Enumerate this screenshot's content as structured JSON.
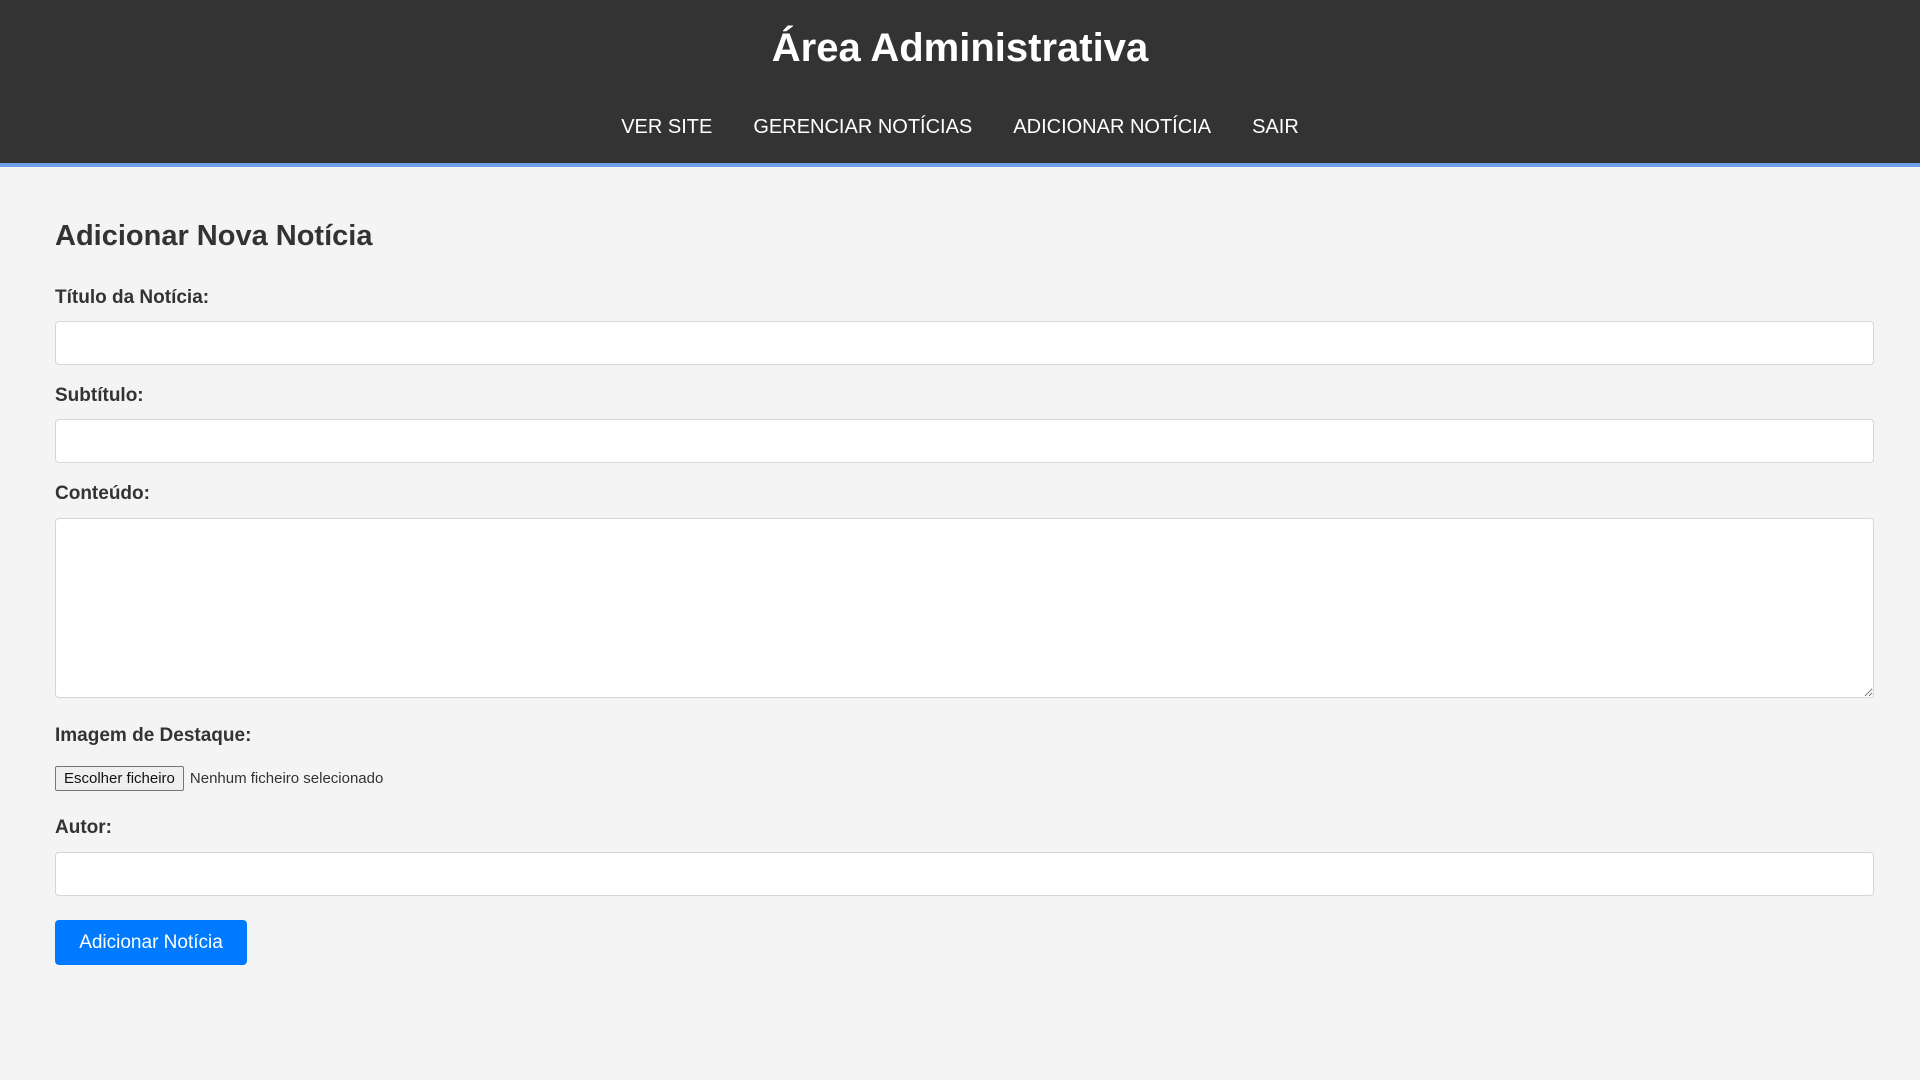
{
  "header": {
    "title": "Área Administrativa",
    "nav": [
      {
        "label": "VER SITE"
      },
      {
        "label": "GERENCIAR NOTÍCIAS"
      },
      {
        "label": "ADICIONAR NOTÍCIA"
      },
      {
        "label": "SAIR"
      }
    ]
  },
  "form": {
    "heading": "Adicionar Nova Notícia",
    "title_label": "Título da Notícia:",
    "title_value": "",
    "subtitle_label": "Subtítulo:",
    "subtitle_value": "",
    "content_label": "Conteúdo:",
    "content_value": "",
    "image_label": "Imagem de Destaque:",
    "file_button_label": "Escolher ficheiro",
    "file_status": "Nenhum ficheiro selecionado",
    "author_label": "Autor:",
    "author_value": "",
    "submit_label": "Adicionar Notícia"
  },
  "colors": {
    "header_bg": "#333333",
    "header_border": "#6f9ee8",
    "page_bg": "#f4f4f4",
    "primary_button": "#007bff"
  }
}
